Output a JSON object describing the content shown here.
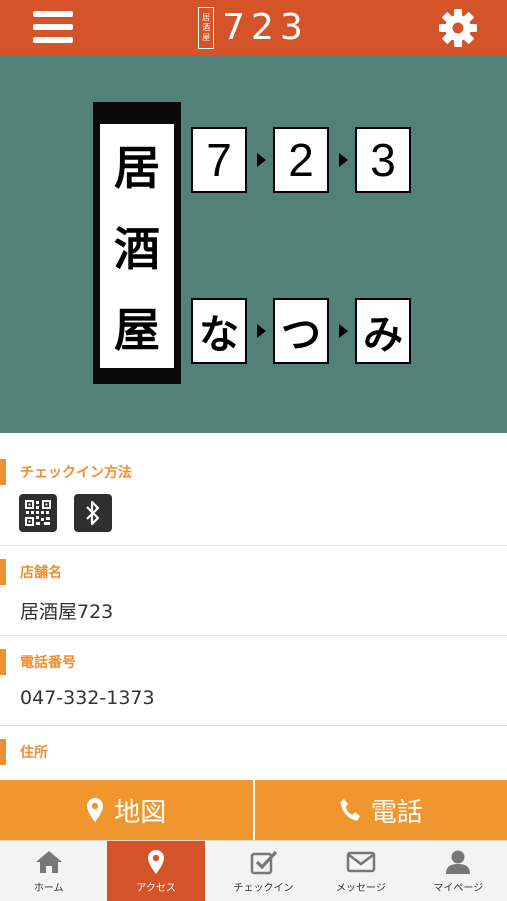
{
  "header": {
    "logo_small": [
      "居",
      "酒",
      "屋"
    ],
    "logo_number": "723"
  },
  "banner": {
    "vertical": [
      "居",
      "酒",
      "屋"
    ],
    "top_row": [
      "7",
      "2",
      "3"
    ],
    "bottom_row": [
      "な",
      "つ",
      "み"
    ],
    "bg_color": "#518178"
  },
  "sections": {
    "checkin": {
      "title": "チェックイン方法"
    },
    "store": {
      "title": "店舗名",
      "value": "居酒屋723"
    },
    "phone": {
      "title": "電話番号",
      "value": "047-332-1373"
    },
    "address": {
      "title": "住所"
    }
  },
  "actions": {
    "map_label": "地図",
    "call_label": "電話"
  },
  "nav": {
    "items": [
      {
        "label": "ホーム"
      },
      {
        "label": "アクセス"
      },
      {
        "label": "チェックイン"
      },
      {
        "label": "メッセージ"
      },
      {
        "label": "マイページ"
      }
    ]
  },
  "colors": {
    "header": "#d55328",
    "accent": "#ef962f"
  }
}
